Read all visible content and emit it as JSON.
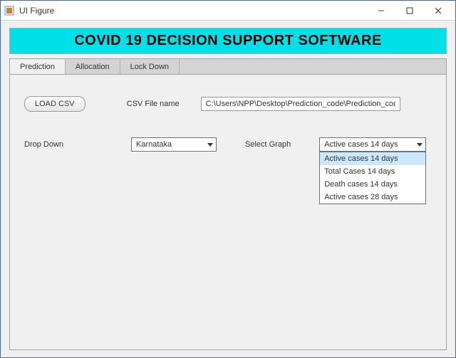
{
  "window": {
    "title": "UI Figure"
  },
  "banner": {
    "title": "COVID 19 DECISION SUPPORT SOFTWARE"
  },
  "tabs": [
    {
      "label": "Prediction"
    },
    {
      "label": "Allocation"
    },
    {
      "label": "Lock Down"
    }
  ],
  "controls": {
    "load_csv_label": "LOAD CSV",
    "csv_filename_label": "CSV File name",
    "csv_filename_value": "C:\\Users\\NPP\\Desktop\\Prediction_code\\Prediction_code\\state_wise",
    "dropdown_label": "Drop Down",
    "dropdown_value": "Karnataka",
    "select_graph_label": "Select Graph",
    "select_graph_value": "Active cases 14 days",
    "select_graph_options": [
      "Active cases 14 days",
      "Total Cases 14 days",
      "Death cases 14 days",
      "Active cases 28 days"
    ]
  }
}
